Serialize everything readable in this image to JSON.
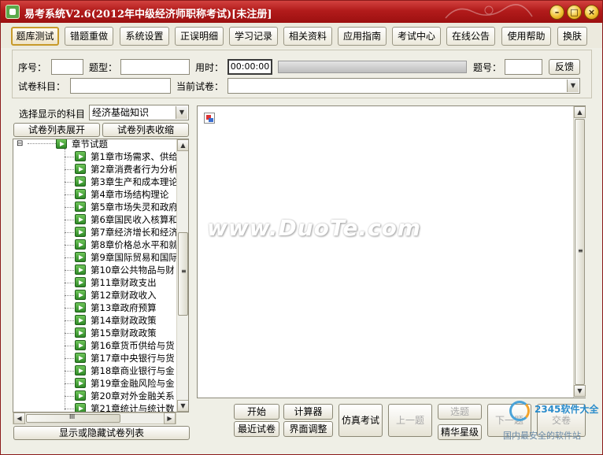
{
  "window": {
    "title": "易考系统V2.6(2012年中级经济师职称考试)[未注册]",
    "controls": {
      "minimize": "–",
      "maximize": "□",
      "close": "×"
    }
  },
  "menu": {
    "items": [
      "题库测试",
      "错题重做",
      "系统设置",
      "正误明细",
      "学习记录",
      "相关资料",
      "应用指南",
      "考试中心",
      "在线公告",
      "使用帮助",
      "换肤"
    ],
    "active_index": 0
  },
  "info_panel": {
    "seq_label": "序号：",
    "seq_value": "",
    "type_label": "题型：",
    "type_value": "",
    "time_label": "用时：",
    "time_value": "00:00:00",
    "qnum_label": "题号：",
    "qnum_value": "",
    "feedback_button": "反馈",
    "subject_label": "试卷科目：",
    "subject_value": "",
    "current_paper_label": "当前试卷：",
    "current_paper_value": ""
  },
  "left_panel": {
    "subject_select_label": "选择显示的科目",
    "subject_select_value": "经济基础知识",
    "expand_button": "试卷列表展开",
    "collapse_button": "试卷列表收缩",
    "tree_root": "章节试题",
    "tree_root_toggle": "⊟",
    "chapters": [
      "第1章市场需求、供给",
      "第2章消费者行为分析",
      "第3章生产和成本理论",
      "第4章市场结构理论",
      "第5章市场失灵和政府",
      "第6章国民收入核算和",
      "第7章经济增长和经济",
      "第8章价格总水平和就",
      "第9章国际贸易和国际",
      "第10章公共物品与财",
      "第11章财政支出",
      "第12章财政收入",
      "第13章政府预算",
      "第14章财政政策",
      "第15章财政政策",
      "第16章货币供给与货",
      "第17章中央银行与货",
      "第18章商业银行与金",
      "第19章金融风险与金",
      "第20章对外金融关系",
      "第21章统计与统计数"
    ],
    "toggle_list_button": "显示或隐藏试卷列表",
    "hscroll_grip": "III",
    "vscroll_grip": "≡"
  },
  "content": {
    "watermark": "www.DuoTe.com",
    "vscroll_grip": "≡"
  },
  "bottom_buttons": {
    "start": "开始",
    "calculator": "计算器",
    "recent_papers": "最近试卷",
    "ui_adjust": "界面调整",
    "mock_exam": "仿真考试",
    "prev_question": "上一题",
    "select_question": "选题",
    "elite_stars": "精华星级",
    "next_question": "下一题",
    "submit": "交卷"
  },
  "overlay_logo": {
    "brand": "2345软件大全",
    "tagline": "国内最安全的软件站"
  }
}
